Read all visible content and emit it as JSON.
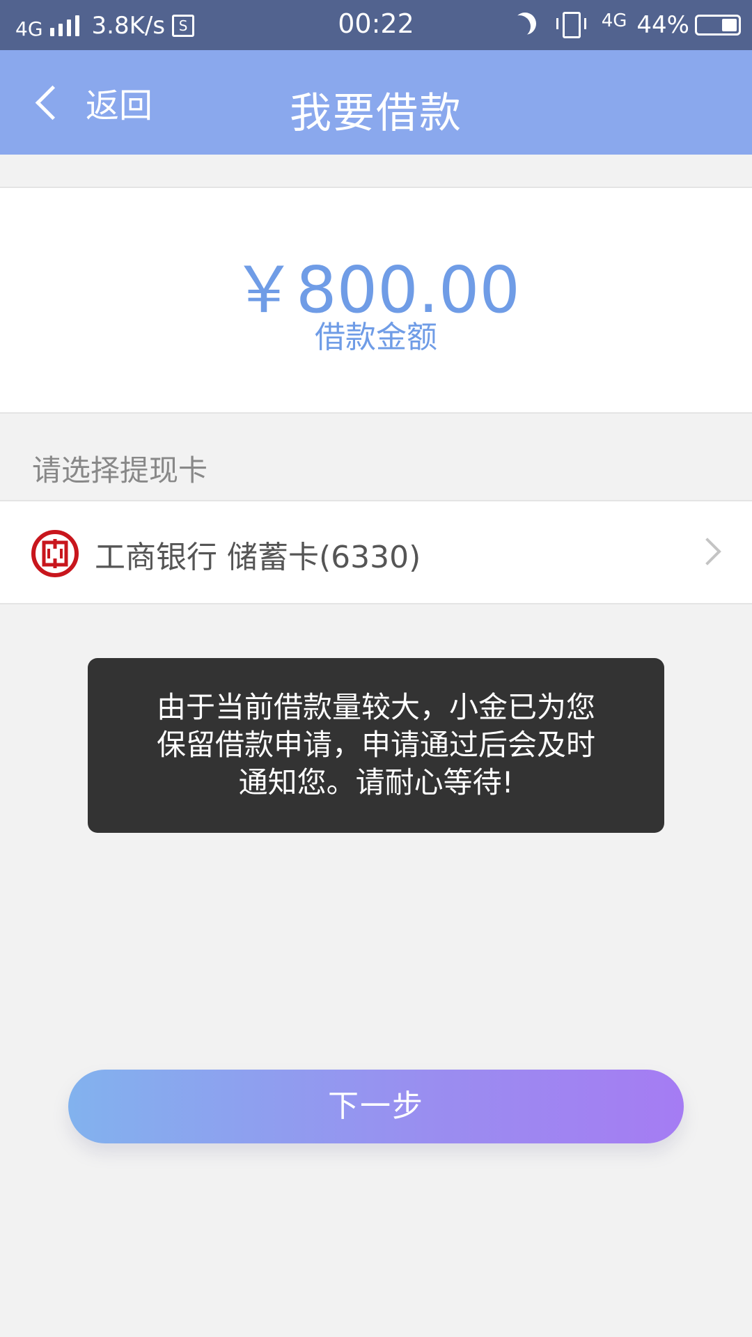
{
  "status_bar": {
    "network_left": "4G",
    "speed": "3.8K/s",
    "s_icon_label": "S",
    "time": "00:22",
    "network_right": "4G",
    "battery_percent": "44%"
  },
  "nav": {
    "back_label": "返回",
    "title": "我要借款"
  },
  "amount": {
    "value": "￥800.00",
    "label": "借款金额"
  },
  "withdraw": {
    "section_label": "请选择提现卡",
    "card_text": "工商银行 储蓄卡(6330)"
  },
  "toast": {
    "line1": "由于当前借款量较大，小金已为您",
    "line2": "保留借款申请，申请通过后会及时",
    "line3": "通知您。请耐心等待!"
  },
  "actions": {
    "next_label": "下一步"
  },
  "colors": {
    "status_bar": "#52638f",
    "nav_bar": "#8aa8ed",
    "accent": "#6f9ce6",
    "bank_red": "#c8161d",
    "button_gradient_start": "#82b2ee",
    "button_gradient_end": "#a57cf3"
  },
  "icons": {
    "back": "chevron-left-icon",
    "bank": "icbc-logo-icon",
    "row_arrow": "chevron-right-icon"
  }
}
